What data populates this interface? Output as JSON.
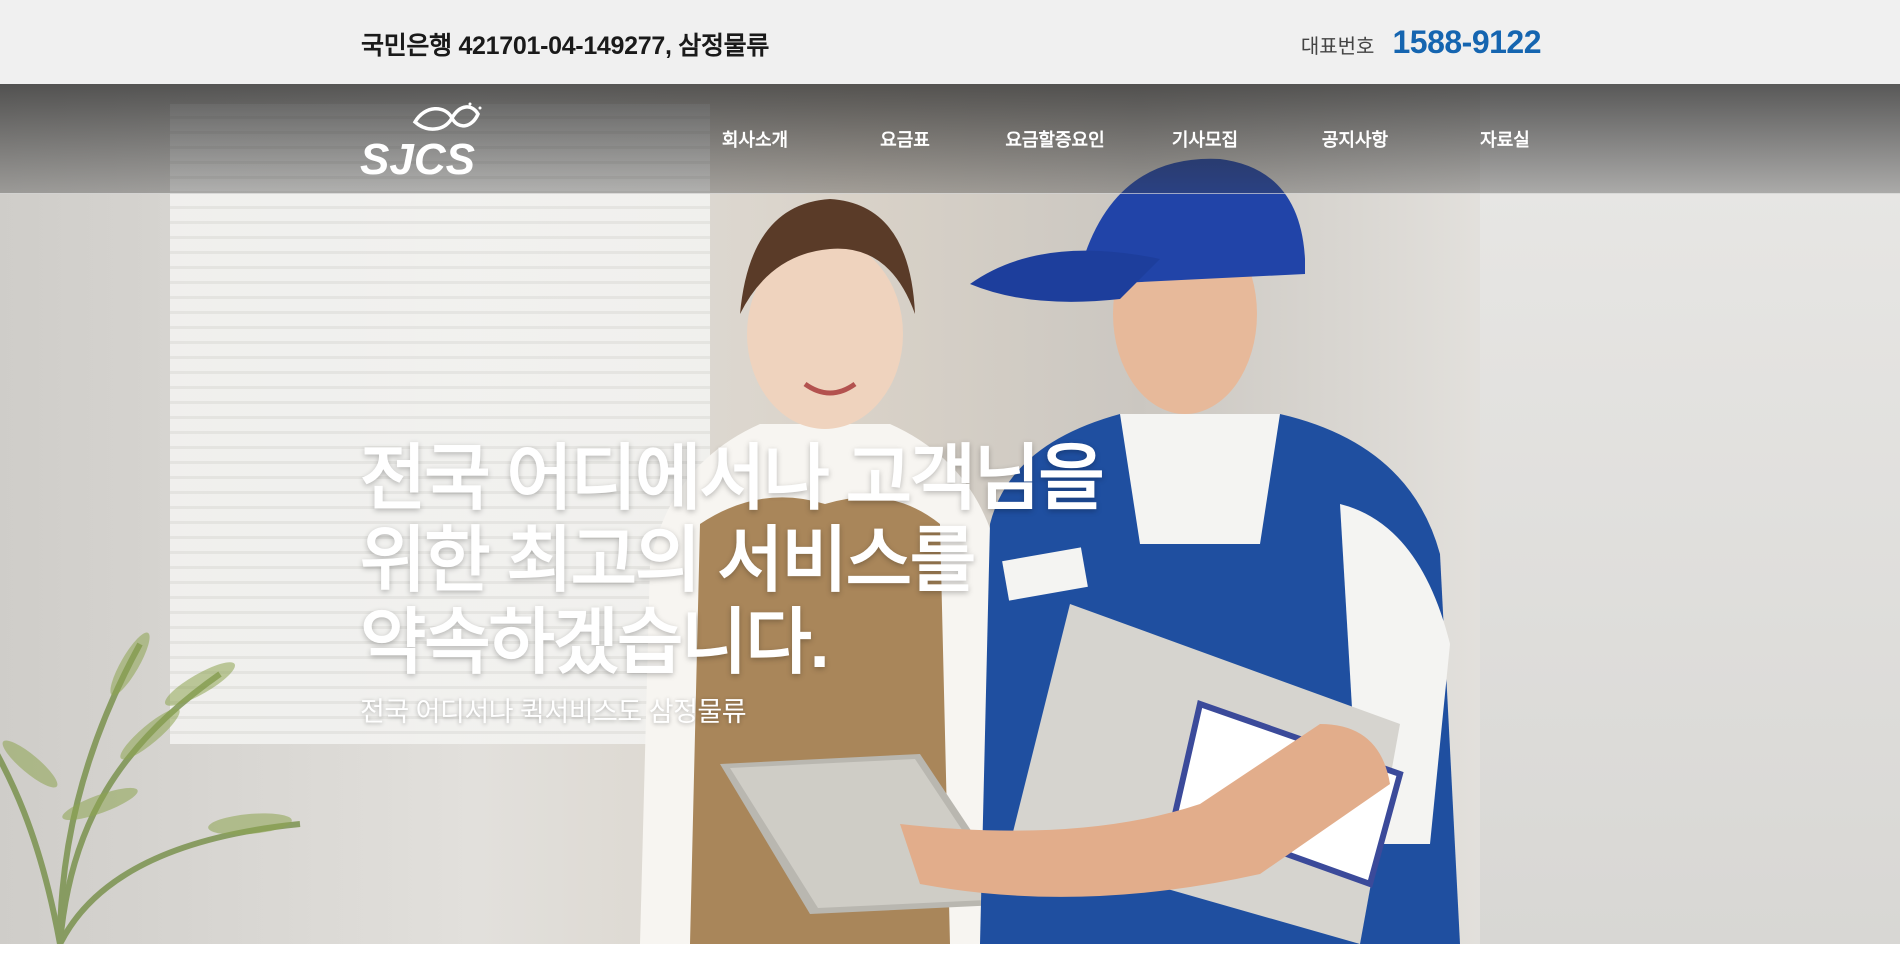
{
  "topbar": {
    "bank_info": "국민은행 421701-04-149277, 삼정물류",
    "phone_label": "대표번호",
    "phone_number": "1588-9122"
  },
  "logo": {
    "text": "SJCS",
    "icon": "infinity-swoosh-logo"
  },
  "nav": {
    "items": [
      {
        "label": "회사소개"
      },
      {
        "label": "요금표"
      },
      {
        "label": "요금할증요인"
      },
      {
        "label": "기사모집"
      },
      {
        "label": "공지사항"
      },
      {
        "label": "자료실"
      }
    ]
  },
  "hero": {
    "headline_lines": [
      "전국 어디에서나 고객님을",
      "위한 최고의 서비스를",
      "약속하겠습니다."
    ],
    "subline": "전국 어디서나 퀵서비스도 삼정물류",
    "image": "courier-and-customer-photo"
  },
  "colors": {
    "phone": "#1565b0",
    "topbar_bg": "#f0f0f0",
    "nav_text": "#ffffff"
  }
}
